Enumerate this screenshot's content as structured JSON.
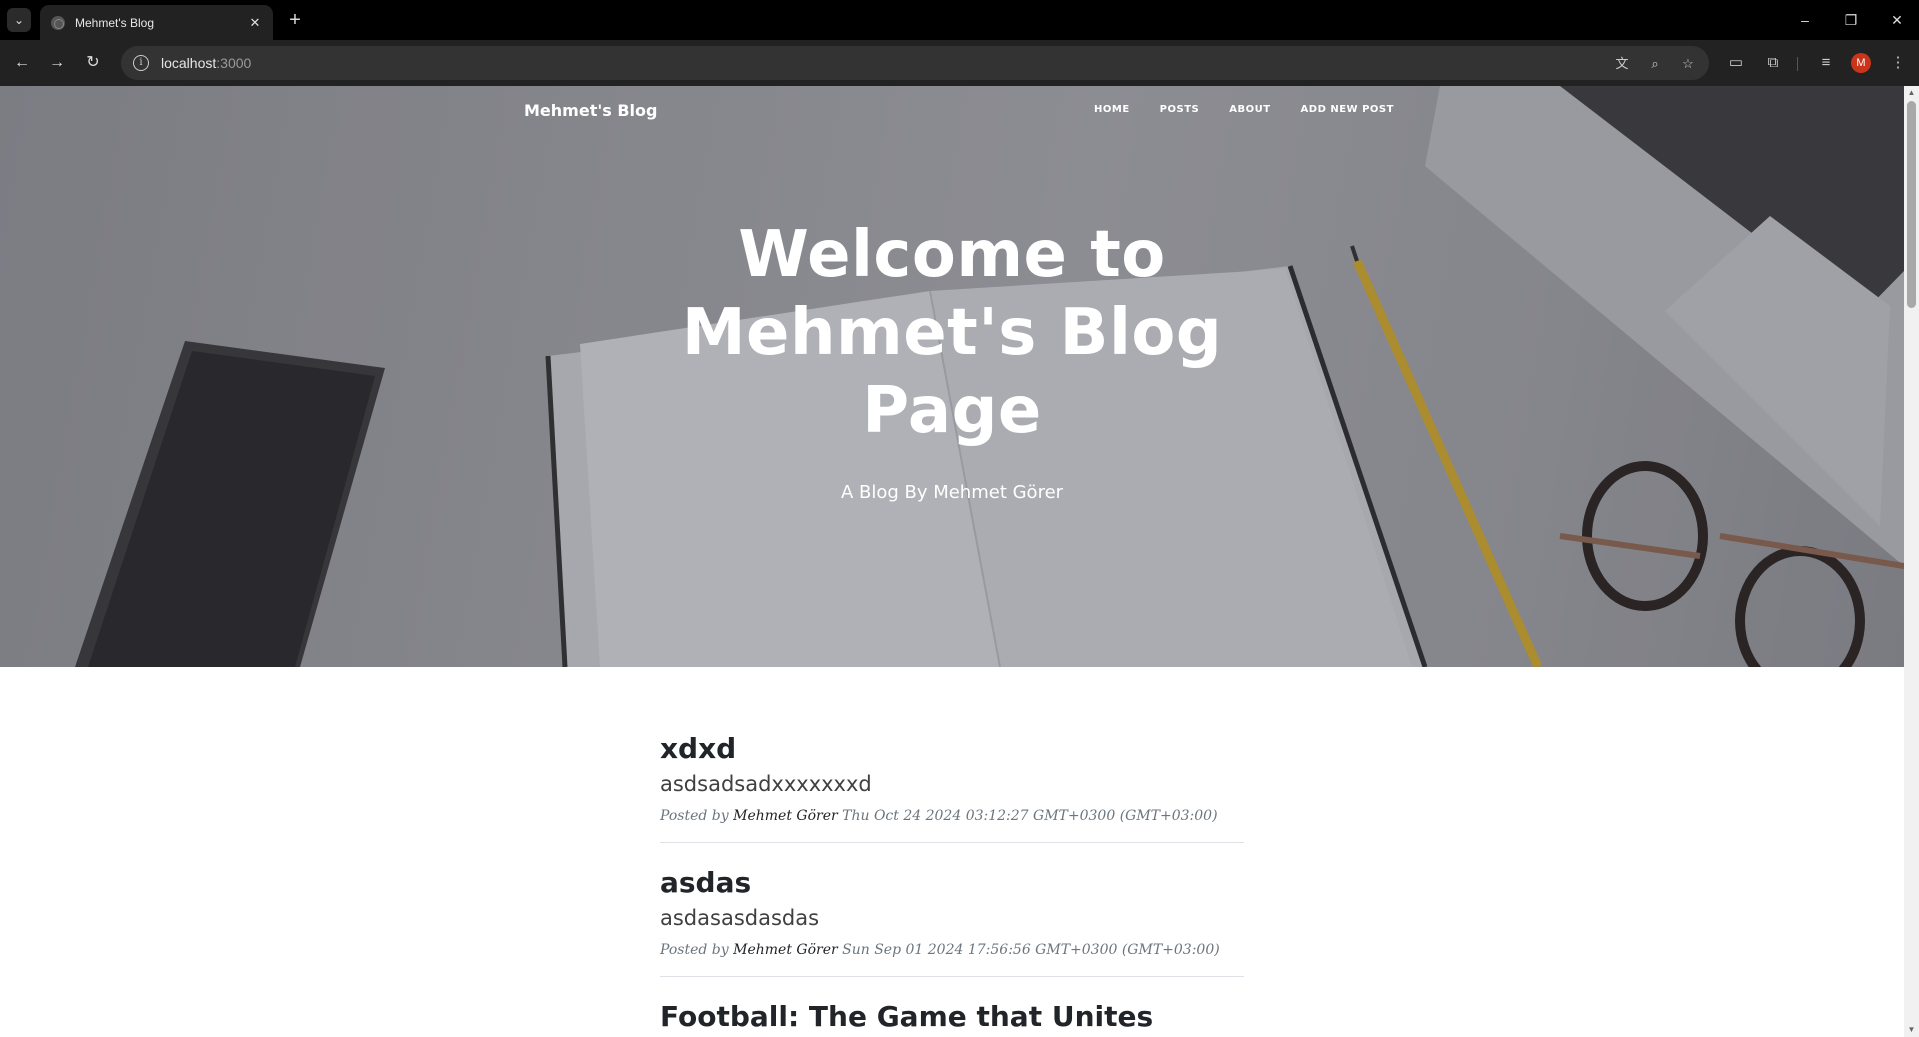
{
  "browser": {
    "tab_title": "Mehmet's Blog",
    "url_host": "localhost",
    "url_port": ":3000",
    "profile_initial": "M",
    "icons": [
      "tab-search-icon",
      "favicon-icon",
      "close-icon",
      "new-tab-icon",
      "minimize-icon",
      "restore-icon",
      "window-close-icon",
      "back-icon",
      "forward-icon",
      "reload-icon",
      "site-info-icon",
      "translate-icon",
      "zoom-icon",
      "bookmark-star-icon",
      "cast-icon",
      "extensions-icon",
      "media-icon",
      "menu-icon"
    ]
  },
  "site": {
    "brand": "Mehmet's Blog",
    "nav": {
      "home": "Home",
      "posts": "Posts",
      "about": "About",
      "add_new_post": "Add New Post"
    },
    "hero": {
      "title": "Welcome to Mehmet's Blog Page",
      "subtitle": "A Blog By Mehmet Görer"
    }
  },
  "posts": [
    {
      "title": "xdxd",
      "subtitle": "asdsadsadxxxxxxxd",
      "meta_prefix": "Posted by ",
      "author": "Mehmet Görer",
      "date": " Thu Oct 24 2024 03:12:27 GMT+0300 (GMT+03:00)"
    },
    {
      "title": "asdas",
      "subtitle": "asdasasdasdas",
      "meta_prefix": "Posted by ",
      "author": "Mehmet Görer",
      "date": " Sun Sep 01 2024 17:56:56 GMT+0300 (GMT+03:00)"
    },
    {
      "title": "Football: The Game that Unites",
      "subtitle": "",
      "meta_prefix": "",
      "author": "",
      "date": ""
    }
  ]
}
